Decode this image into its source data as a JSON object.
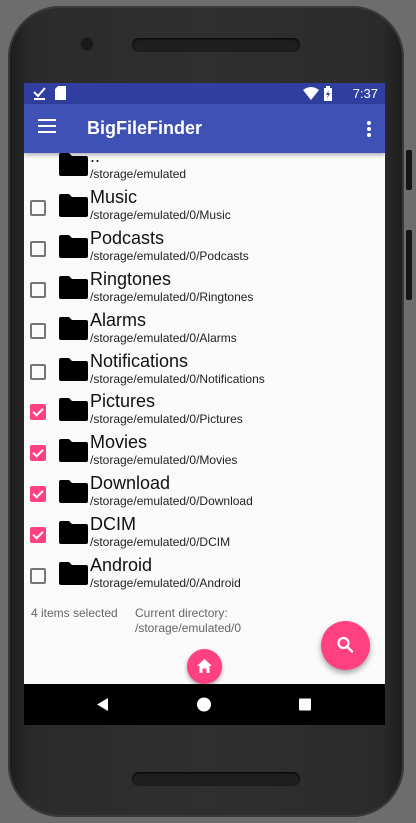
{
  "status_bar": {
    "time": "7:37",
    "left_icons": [
      "download-done-icon",
      "sd-card-icon"
    ],
    "right_icons": [
      "wifi-icon",
      "battery-charging-icon"
    ]
  },
  "app_bar": {
    "title": "BigFileFinder",
    "menu_icon": "hamburger-menu-icon",
    "overflow_icon": "overflow-menu-icon"
  },
  "folders": [
    {
      "name": "..",
      "path": "/storage/emulated",
      "checkbox": false,
      "checked": false
    },
    {
      "name": "Music",
      "path": "/storage/emulated/0/Music",
      "checkbox": true,
      "checked": false
    },
    {
      "name": "Podcasts",
      "path": "/storage/emulated/0/Podcasts",
      "checkbox": true,
      "checked": false
    },
    {
      "name": "Ringtones",
      "path": "/storage/emulated/0/Ringtones",
      "checkbox": true,
      "checked": false
    },
    {
      "name": "Alarms",
      "path": "/storage/emulated/0/Alarms",
      "checkbox": true,
      "checked": false
    },
    {
      "name": "Notifications",
      "path": "/storage/emulated/0/Notifications",
      "checkbox": true,
      "checked": false
    },
    {
      "name": "Pictures",
      "path": "/storage/emulated/0/Pictures",
      "checkbox": true,
      "checked": true
    },
    {
      "name": "Movies",
      "path": "/storage/emulated/0/Movies",
      "checkbox": true,
      "checked": true
    },
    {
      "name": "Download",
      "path": "/storage/emulated/0/Download",
      "checkbox": true,
      "checked": true
    },
    {
      "name": "DCIM",
      "path": "/storage/emulated/0/DCIM",
      "checkbox": true,
      "checked": true
    },
    {
      "name": "Android",
      "path": "/storage/emulated/0/Android",
      "checkbox": true,
      "checked": false
    }
  ],
  "footer": {
    "selected_text": "4 items selected",
    "current_dir_label": "Current directory:",
    "current_dir": "/storage/emulated/0"
  },
  "fab": {
    "icon": "search-icon"
  },
  "home_button": {
    "icon": "home-icon"
  },
  "nav_bar": {
    "icons": [
      "back-icon",
      "home-circle-icon",
      "recents-icon"
    ]
  },
  "colors": {
    "status_bar": "#303f9f",
    "app_bar": "#3f51b5",
    "accent": "#ff4081",
    "background": "#fafafa"
  }
}
